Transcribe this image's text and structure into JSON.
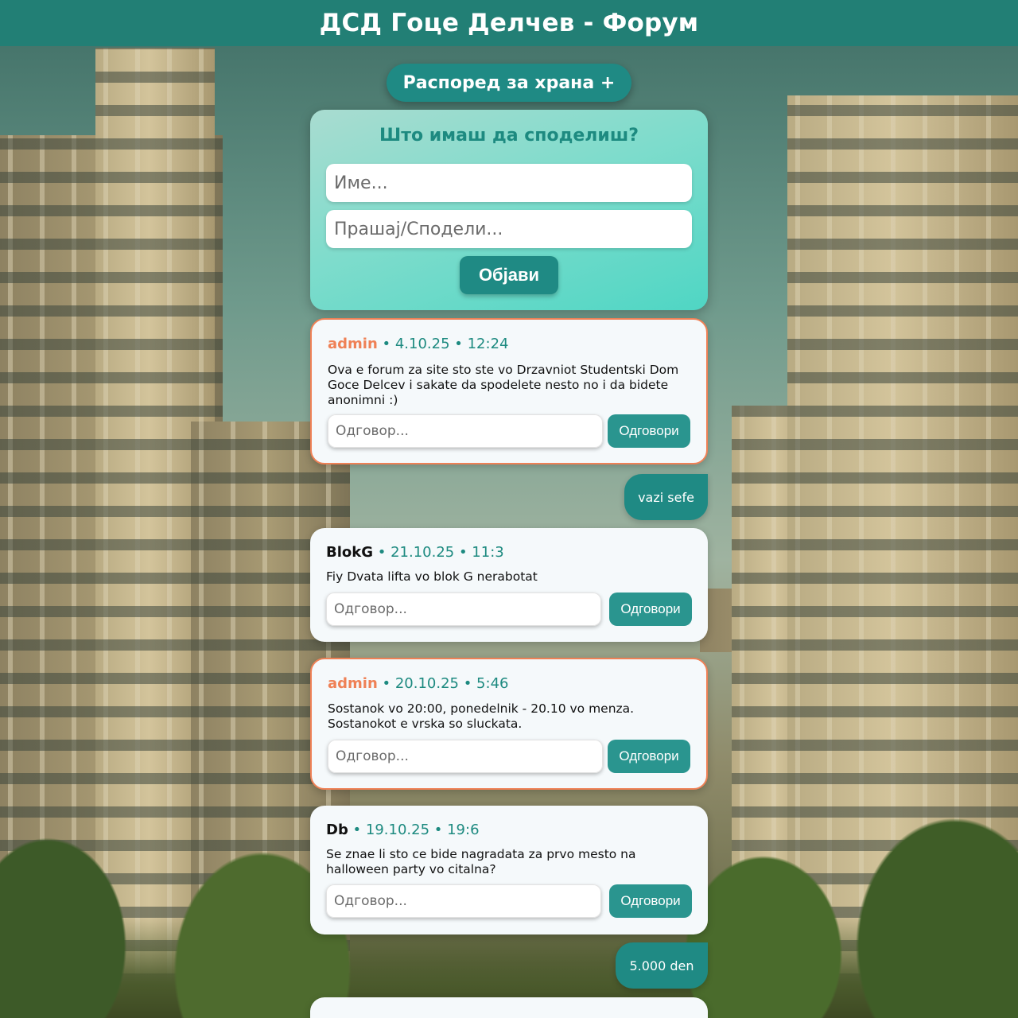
{
  "header": {
    "title": "ДСД Гоце Делчев - Форум"
  },
  "food_schedule_button": {
    "label": "Распоред за храна +"
  },
  "compose": {
    "heading": "Што имаш да споделиш?",
    "name_placeholder": "Име...",
    "message_placeholder": "Прашај/Сподели...",
    "post_label": "Објави"
  },
  "reply_placeholder": "Одговор...",
  "reply_button_label": "Одговори",
  "posts": [
    {
      "author": "admin",
      "meta": " • 4.10.25 • 12:24",
      "text": "Ova e forum za site sto ste vo Drzavniot Studentski Dom Goce Delcev i sakate da spodelete nesto no i da bidete anonimni :)",
      "reply_text": "vazi sefe"
    },
    {
      "author": "BlokG",
      "meta": " • 21.10.25 • 11:3",
      "text": "Fiy Dvata lifta vo blok G nerabotat"
    },
    {
      "author": "admin",
      "meta": " • 20.10.25 • 5:46",
      "text": "Sostanok vo 20:00, ponedelnik - 20.10 vo menza. Sostanokot e vrska so sluckata."
    },
    {
      "author": "Db",
      "meta": " • 19.10.25 • 19:6",
      "text": "Se znae li sto ce bide nagradata za prvo mesto na halloween party vo citalna?",
      "reply_text": "5.000 den"
    }
  ],
  "colors": {
    "header": "#1f8076",
    "accent": "#1f8a84",
    "admin": "#ef8156"
  }
}
